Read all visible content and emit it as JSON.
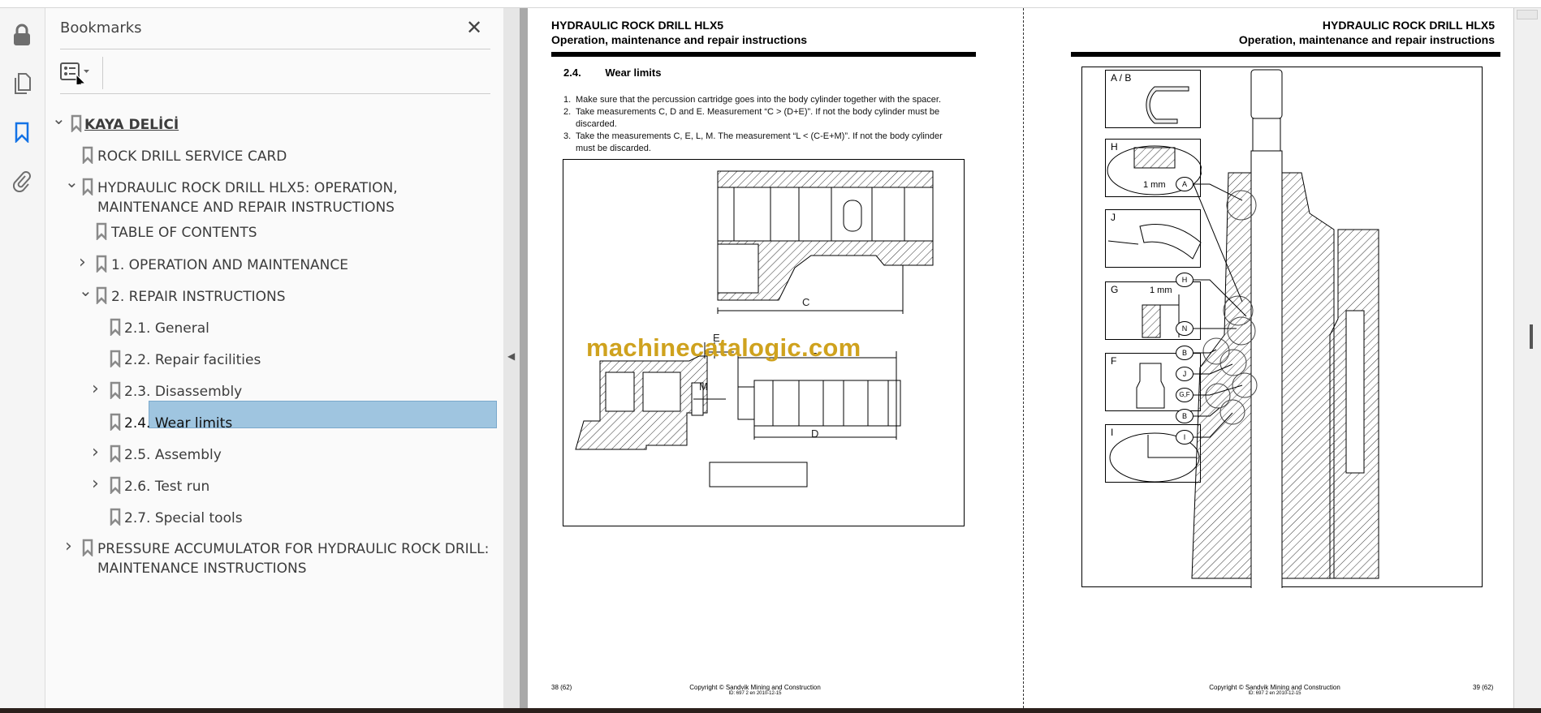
{
  "sidebar_rail": {
    "icons": [
      "lock-icon",
      "pages-icon",
      "bookmark-icon",
      "attachment-icon"
    ]
  },
  "panel": {
    "title": "Bookmarks",
    "close": "✕",
    "items": [
      {
        "label": "KAYA DELİCİ",
        "level": 0,
        "chevron": "down"
      },
      {
        "label": "ROCK DRILL SERVICE CARD",
        "level": 1,
        "chevron": "none"
      },
      {
        "label": "HYDRAULIC ROCK DRILL HLX5: OPERATION,",
        "label2": "MAINTENANCE AND REPAIR INSTRUCTIONS",
        "level": 1,
        "chevron": "down"
      },
      {
        "label": "TABLE OF CONTENTS",
        "level": 2,
        "chevron": "none"
      },
      {
        "label": "1. OPERATION AND MAINTENANCE",
        "level": 2,
        "chevron": "right"
      },
      {
        "label": "2. REPAIR INSTRUCTIONS",
        "level": 2,
        "chevron": "down"
      },
      {
        "label": "2.1. General",
        "level": 3,
        "chevron": "none"
      },
      {
        "label": "2.2. Repair facilities",
        "level": 3,
        "chevron": "none"
      },
      {
        "label": "2.3. Disassembly",
        "level": 3,
        "chevron": "right"
      },
      {
        "label": "2.4. Wear limits",
        "level": 3,
        "chevron": "none",
        "selected": true
      },
      {
        "label": "2.5. Assembly",
        "level": 3,
        "chevron": "right"
      },
      {
        "label": "2.6. Test run",
        "level": 3,
        "chevron": "right"
      },
      {
        "label": "2.7. Special tools",
        "level": 3,
        "chevron": "none"
      },
      {
        "label": "PRESSURE ACCUMULATOR FOR HYDRAULIC ROCK DRILL:",
        "label2": "MAINTENANCE INSTRUCTIONS",
        "level": 1,
        "chevron": "right"
      }
    ]
  },
  "left_page": {
    "header1": "HYDRAULIC ROCK DRILL HLX5",
    "header2": "Operation, maintenance and repair instructions",
    "section_num": "2.4.",
    "section_title": "Wear limits",
    "steps": [
      {
        "n": "1.",
        "text": "Make sure that the percussion cartridge goes into the body cylinder together with the spacer."
      },
      {
        "n": "2.",
        "text": "Take measurements C, D and E. Measurement “C > (D+E)”. If not the body cylinder must be",
        "cont": "discarded."
      },
      {
        "n": "3.",
        "text": "Take the measurements C, E, L, M. The measurement “L < (C-E+M)”. If not the body cylinder",
        "cont": "must be discarded."
      }
    ],
    "figure_labels": {
      "C": "C",
      "E": "E",
      "M": "M",
      "L": "L",
      "D": "D"
    },
    "watermark": "machinecatalogic.com",
    "page_num": "38 (62)",
    "copyright": "Copyright © Sandvik Mining and Construction",
    "doc_id": "ID: 697 2 en 2010-12-15"
  },
  "right_page": {
    "header1": "HYDRAULIC ROCK DRILL HLX5",
    "header2": "Operation, maintenance and repair instructions",
    "insets": [
      {
        "title": "A / B"
      },
      {
        "title": "H",
        "note": "1 mm"
      },
      {
        "title": "J"
      },
      {
        "title": "G",
        "note": "1 mm"
      },
      {
        "title": "F"
      },
      {
        "title": "I"
      }
    ],
    "callouts": [
      "A",
      "H",
      "N",
      "B",
      "J",
      "G,F",
      "B",
      "I"
    ],
    "page_num": "39 (62)",
    "copyright": "Copyright © Sandvik Mining and Construction",
    "doc_id": "ID: 697 2 en 2010-12-15"
  },
  "colors": {
    "selection": "#9fc5e0",
    "watermark": "#cfa21e",
    "accent": "#1473e6"
  }
}
